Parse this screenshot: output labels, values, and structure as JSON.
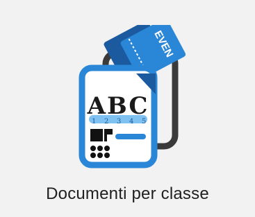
{
  "tile": {
    "label": "Documenti per classe",
    "icon": "documents-per-class-icon"
  },
  "icon_text": {
    "letters": "ABC",
    "numbers": [
      "1",
      "2",
      "3",
      "4",
      "5"
    ],
    "ticket": "EVEN"
  },
  "colors": {
    "background": "#f2f2f2",
    "blue": "#2a86d6",
    "dark_blue": "#1b5a9e",
    "light_blue": "#7fc2f2",
    "outline": "#3a3a3a",
    "text": "#1f1f1f"
  }
}
